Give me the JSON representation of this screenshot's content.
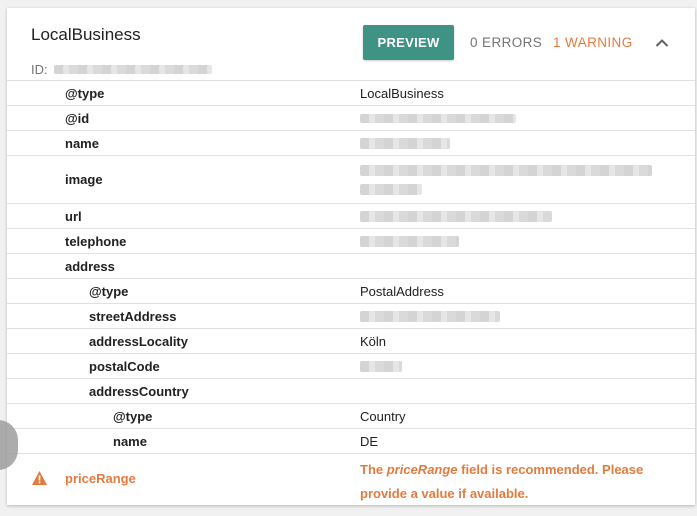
{
  "card": {
    "title": "LocalBusiness",
    "id_label": "ID:",
    "preview_label": "PREVIEW",
    "errors": "0 ERRORS",
    "warnings": "1 WARNING",
    "collapse_icon": "chevron-up-icon",
    "accent_color": "#3f9384",
    "warning_color": "#e37b40"
  },
  "rows": [
    {
      "key": "@type",
      "value": "LocalBusiness"
    },
    {
      "key": "@id",
      "value": ""
    },
    {
      "key": "name",
      "value": ""
    },
    {
      "key": "image",
      "value": ""
    },
    {
      "key": "url",
      "value": ""
    },
    {
      "key": "telephone",
      "value": ""
    },
    {
      "key": "address",
      "value": ""
    },
    {
      "key": "@type",
      "value": "PostalAddress"
    },
    {
      "key": "streetAddress",
      "value": ""
    },
    {
      "key": "addressLocality",
      "value": "Köln"
    },
    {
      "key": "postalCode",
      "value": ""
    },
    {
      "key": "addressCountry",
      "value": ""
    },
    {
      "key": "@type",
      "value": "Country"
    },
    {
      "key": "name",
      "value": "DE"
    }
  ],
  "warning_row": {
    "key": "priceRange",
    "msg_prefix": "The ",
    "msg_field": "priceRange",
    "msg_suffix": " field is recommended. Please provide a value if available.",
    "icon": "warning-triangle-icon"
  }
}
